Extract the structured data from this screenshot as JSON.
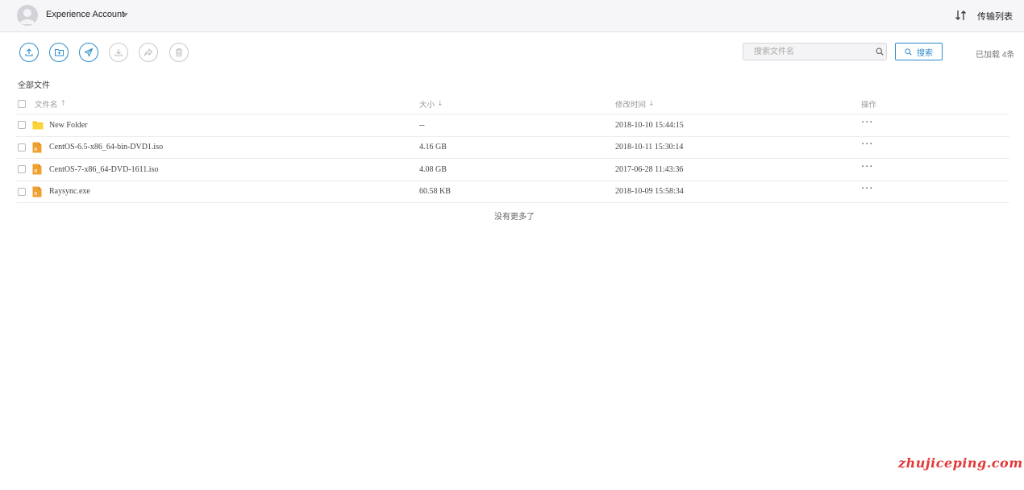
{
  "header": {
    "account_name": "Experience Account",
    "transfer_label": "传输列表"
  },
  "toolbar": {
    "buttons": [
      {
        "name": "upload",
        "icon": "upload-icon",
        "enabled": true
      },
      {
        "name": "new-folder",
        "icon": "new-folder-icon",
        "enabled": true
      },
      {
        "name": "send",
        "icon": "paper-plane-icon",
        "enabled": true
      },
      {
        "name": "download",
        "icon": "download-icon",
        "enabled": false
      },
      {
        "name": "share",
        "icon": "share-icon",
        "enabled": false
      },
      {
        "name": "delete",
        "icon": "trash-icon",
        "enabled": false
      }
    ],
    "accent_color": "#2e8bc9",
    "disabled_color": "#c8c8c8"
  },
  "search": {
    "placeholder": "搜索文件名",
    "value": "",
    "button_label": "搜索"
  },
  "loaded_count": "已加载 4条",
  "breadcrumb": "全部文件",
  "table": {
    "columns": {
      "name": "文件名",
      "size": "大小",
      "modified": "修改时间",
      "actions": "操作"
    },
    "sort_arrows": {
      "name": "↑",
      "size": "↓",
      "modified": "↓"
    },
    "rows": [
      {
        "icon": "folder-icon",
        "name": "New Folder",
        "size": "--",
        "modified": "2018-10-10 15:44:15",
        "ops": "···"
      },
      {
        "icon": "file-icon",
        "name": "CentOS-6.5-x86_64-bin-DVD1.iso",
        "size": "4.16 GB",
        "modified": "2018-10-11 15:30:14",
        "ops": "···"
      },
      {
        "icon": "file-icon",
        "name": "CentOS-7-x86_64-DVD-1611.iso",
        "size": "4.08 GB",
        "modified": "2017-06-28 11:43:36",
        "ops": "···"
      },
      {
        "icon": "file-icon",
        "name": "Raysync.exe",
        "size": "60.58 KB",
        "modified": "2018-10-09 15:58:34",
        "ops": "···"
      }
    ]
  },
  "no_more": "没有更多了",
  "watermark": "zhujiceping.com"
}
